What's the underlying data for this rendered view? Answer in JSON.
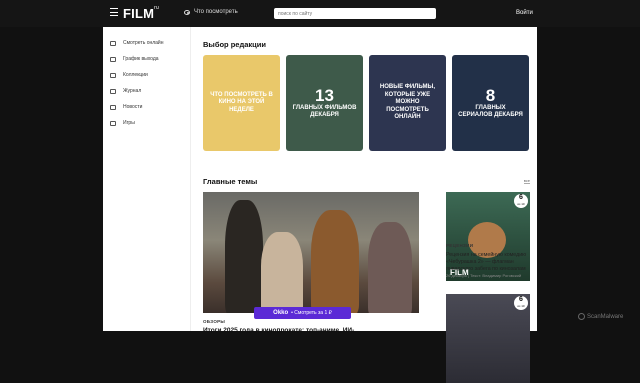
{
  "header": {
    "logo": "FILM",
    "logo_sup": "ru",
    "watch_label": "Что посмотреть",
    "search_placeholder": "поиск по сайту",
    "login_label": "Войти"
  },
  "sidebar": {
    "items": [
      {
        "label": "Смотреть онлайн",
        "icon": "play-icon"
      },
      {
        "label": "График выхода",
        "icon": "calendar-icon"
      },
      {
        "label": "Коллекции",
        "icon": "collection-icon"
      },
      {
        "label": "Журнал",
        "icon": "journal-icon"
      },
      {
        "label": "Новости",
        "icon": "news-icon"
      },
      {
        "label": "Игры",
        "icon": "gamepad-icon"
      }
    ]
  },
  "editors": {
    "title": "Выбор редакции",
    "cards": [
      {
        "num": "",
        "text": "Что посмотреть в кино на этой неделе",
        "color": "#e9c86a"
      },
      {
        "num": "13",
        "text": "главных фильмов декабря",
        "color": "#3e5a4a"
      },
      {
        "num": "",
        "text": "Новые фильмы, которые уже можно посмотреть онлайн",
        "color": "#2d3550"
      },
      {
        "num": "8",
        "text": "главных сериалов декабря",
        "color": "#223048"
      }
    ]
  },
  "topics": {
    "title": "Главные темы",
    "all_label": "все",
    "feature_tag": "ОБЗОРЫ",
    "feature_title": "Итоги 2025 года в кинопрокате: топ-аниме, ИИ-",
    "okko_brand": "Okko",
    "okko_text": "• Смотреть за 1 ₽",
    "side_cards": [
      {
        "badge": "6",
        "badge_sub": "из 10",
        "tag": "РЕЦЕНЗИИ",
        "title": "Рецензия на семейную комедию «Чебурашка 2» — флагман январского забега по кинозалам",
        "meta": "26 декабря | Текст: Владимир Роговский"
      },
      {
        "badge": "6",
        "badge_sub": "из 10"
      }
    ]
  },
  "watermark": "ScanMalware"
}
